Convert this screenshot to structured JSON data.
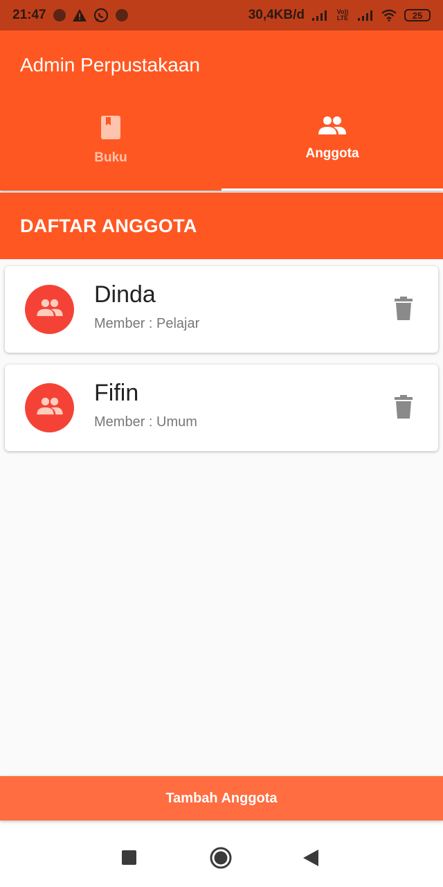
{
  "status_bar": {
    "time": "21:47",
    "network_speed": "30,4KB/d",
    "volte": "Vo)) LTE",
    "battery": "25"
  },
  "app_bar": {
    "title": "Admin Perpustakaan"
  },
  "tabs": [
    {
      "label": "Buku",
      "icon": "book-icon",
      "active": false
    },
    {
      "label": "Anggota",
      "icon": "people-icon",
      "active": true
    }
  ],
  "section": {
    "title": "DAFTAR ANGGOTA"
  },
  "members": [
    {
      "name": "Dinda",
      "type": "Member : Pelajar"
    },
    {
      "name": "Fifin",
      "type": "Member : Umum"
    }
  ],
  "add_button": {
    "label": "Tambah Anggota"
  },
  "colors": {
    "primary": "#ff5722",
    "status_bar": "#bf3e1a",
    "avatar": "#f44336",
    "button": "#ff6d40"
  }
}
